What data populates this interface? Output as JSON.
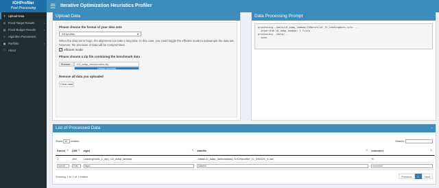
{
  "header": {
    "logo_line1": "IOHProfiler",
    "logo_line2": "Post-Processing",
    "menu_icon": "hamburger-icon",
    "title": "Iterative Optimization Heuristics Profiler"
  },
  "sidebar": {
    "items": [
      {
        "label": "Upload Data",
        "icon": "upload-icon",
        "active": true,
        "chevron": false
      },
      {
        "label": "Fixed-Target Results",
        "icon": "target-icon",
        "active": false,
        "chevron": true
      },
      {
        "label": "Fixed-Budget Results",
        "icon": "budget-icon",
        "active": false,
        "chevron": true
      },
      {
        "label": "Algorithm Parameters",
        "icon": "sliders-icon",
        "active": false,
        "chevron": false
      },
      {
        "label": "Portfolio",
        "icon": "portfolio-icon",
        "active": false,
        "chevron": true
      },
      {
        "label": "About",
        "icon": "info-icon",
        "active": false,
        "chevron": false
      }
    ]
  },
  "upload": {
    "title": "Upload Data",
    "format_label": "Please choose the format of your data sets",
    "format_value": "IOHprofiler",
    "help_text": "When the data set is huge, the alignment can take a long time. In this case, you could toggle the efficient mode to subsample the data set. However, the precision of data will be compromised.",
    "efficient_label": "efficient mode",
    "efficient_checked": true,
    "zip_label": "Please choose a zip file containing the benchmark data",
    "browse_label": "Browse...",
    "file_name": "LD_adap_benchmarks.zip",
    "progress_text": "Upload complete",
    "progress": 1.0,
    "remove_label": "Remove all data you uploaded",
    "clear_label": "Clear data"
  },
  "prompt": {
    "title": "Data Processing Prompt",
    "text": "processing ./data/LD_adap_lambda/IOHprofiler_f1_LeadingOnes.info ...\n  algorithm LD_adap_lambda: 1 files\nprocessing ./data/...\n  done."
  },
  "table": {
    "title": "List of Processed Data",
    "show_label": "Show",
    "show_value": "10",
    "entries_label": "entries",
    "search_label": "Search:",
    "columns": [
      "funcId",
      "DIM",
      "algId",
      "datafile",
      "comment"
    ],
    "rows": [
      [
        "1",
        "100",
        "LeadingOnes_1_dyn_LD_adap_lambda",
        "./data/LD_adap_lambda/data_f1/IOHprofiler_f1_DIM100_i1.dat",
        "%"
      ]
    ],
    "filters": [
      "funcId",
      "DIM",
      "algId",
      "datafile",
      "comment"
    ],
    "info": "Showing 1 to 1 of 1 entries",
    "prev_label": "Previous",
    "page_label": "1",
    "next_label": "Next"
  }
}
